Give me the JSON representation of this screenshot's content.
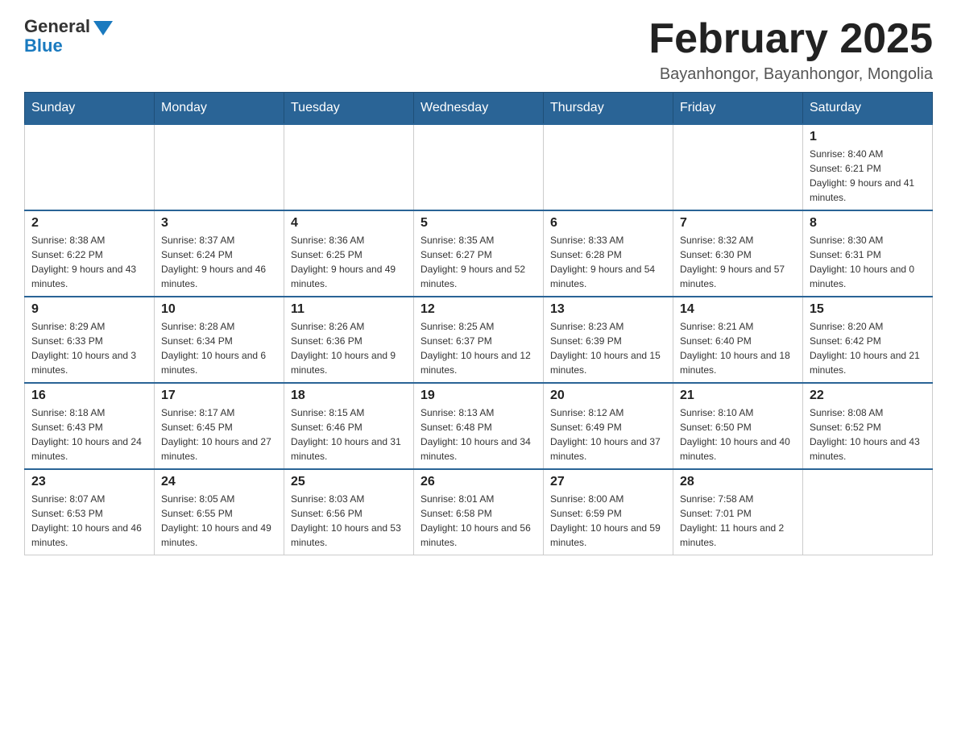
{
  "logo": {
    "general": "General",
    "blue": "Blue"
  },
  "header": {
    "title": "February 2025",
    "location": "Bayanhongor, Bayanhongor, Mongolia"
  },
  "days_of_week": [
    "Sunday",
    "Monday",
    "Tuesday",
    "Wednesday",
    "Thursday",
    "Friday",
    "Saturday"
  ],
  "weeks": [
    [
      {
        "day": "",
        "info": ""
      },
      {
        "day": "",
        "info": ""
      },
      {
        "day": "",
        "info": ""
      },
      {
        "day": "",
        "info": ""
      },
      {
        "day": "",
        "info": ""
      },
      {
        "day": "",
        "info": ""
      },
      {
        "day": "1",
        "info": "Sunrise: 8:40 AM\nSunset: 6:21 PM\nDaylight: 9 hours and 41 minutes."
      }
    ],
    [
      {
        "day": "2",
        "info": "Sunrise: 8:38 AM\nSunset: 6:22 PM\nDaylight: 9 hours and 43 minutes."
      },
      {
        "day": "3",
        "info": "Sunrise: 8:37 AM\nSunset: 6:24 PM\nDaylight: 9 hours and 46 minutes."
      },
      {
        "day": "4",
        "info": "Sunrise: 8:36 AM\nSunset: 6:25 PM\nDaylight: 9 hours and 49 minutes."
      },
      {
        "day": "5",
        "info": "Sunrise: 8:35 AM\nSunset: 6:27 PM\nDaylight: 9 hours and 52 minutes."
      },
      {
        "day": "6",
        "info": "Sunrise: 8:33 AM\nSunset: 6:28 PM\nDaylight: 9 hours and 54 minutes."
      },
      {
        "day": "7",
        "info": "Sunrise: 8:32 AM\nSunset: 6:30 PM\nDaylight: 9 hours and 57 minutes."
      },
      {
        "day": "8",
        "info": "Sunrise: 8:30 AM\nSunset: 6:31 PM\nDaylight: 10 hours and 0 minutes."
      }
    ],
    [
      {
        "day": "9",
        "info": "Sunrise: 8:29 AM\nSunset: 6:33 PM\nDaylight: 10 hours and 3 minutes."
      },
      {
        "day": "10",
        "info": "Sunrise: 8:28 AM\nSunset: 6:34 PM\nDaylight: 10 hours and 6 minutes."
      },
      {
        "day": "11",
        "info": "Sunrise: 8:26 AM\nSunset: 6:36 PM\nDaylight: 10 hours and 9 minutes."
      },
      {
        "day": "12",
        "info": "Sunrise: 8:25 AM\nSunset: 6:37 PM\nDaylight: 10 hours and 12 minutes."
      },
      {
        "day": "13",
        "info": "Sunrise: 8:23 AM\nSunset: 6:39 PM\nDaylight: 10 hours and 15 minutes."
      },
      {
        "day": "14",
        "info": "Sunrise: 8:21 AM\nSunset: 6:40 PM\nDaylight: 10 hours and 18 minutes."
      },
      {
        "day": "15",
        "info": "Sunrise: 8:20 AM\nSunset: 6:42 PM\nDaylight: 10 hours and 21 minutes."
      }
    ],
    [
      {
        "day": "16",
        "info": "Sunrise: 8:18 AM\nSunset: 6:43 PM\nDaylight: 10 hours and 24 minutes."
      },
      {
        "day": "17",
        "info": "Sunrise: 8:17 AM\nSunset: 6:45 PM\nDaylight: 10 hours and 27 minutes."
      },
      {
        "day": "18",
        "info": "Sunrise: 8:15 AM\nSunset: 6:46 PM\nDaylight: 10 hours and 31 minutes."
      },
      {
        "day": "19",
        "info": "Sunrise: 8:13 AM\nSunset: 6:48 PM\nDaylight: 10 hours and 34 minutes."
      },
      {
        "day": "20",
        "info": "Sunrise: 8:12 AM\nSunset: 6:49 PM\nDaylight: 10 hours and 37 minutes."
      },
      {
        "day": "21",
        "info": "Sunrise: 8:10 AM\nSunset: 6:50 PM\nDaylight: 10 hours and 40 minutes."
      },
      {
        "day": "22",
        "info": "Sunrise: 8:08 AM\nSunset: 6:52 PM\nDaylight: 10 hours and 43 minutes."
      }
    ],
    [
      {
        "day": "23",
        "info": "Sunrise: 8:07 AM\nSunset: 6:53 PM\nDaylight: 10 hours and 46 minutes."
      },
      {
        "day": "24",
        "info": "Sunrise: 8:05 AM\nSunset: 6:55 PM\nDaylight: 10 hours and 49 minutes."
      },
      {
        "day": "25",
        "info": "Sunrise: 8:03 AM\nSunset: 6:56 PM\nDaylight: 10 hours and 53 minutes."
      },
      {
        "day": "26",
        "info": "Sunrise: 8:01 AM\nSunset: 6:58 PM\nDaylight: 10 hours and 56 minutes."
      },
      {
        "day": "27",
        "info": "Sunrise: 8:00 AM\nSunset: 6:59 PM\nDaylight: 10 hours and 59 minutes."
      },
      {
        "day": "28",
        "info": "Sunrise: 7:58 AM\nSunset: 7:01 PM\nDaylight: 11 hours and 2 minutes."
      },
      {
        "day": "",
        "info": ""
      }
    ]
  ]
}
